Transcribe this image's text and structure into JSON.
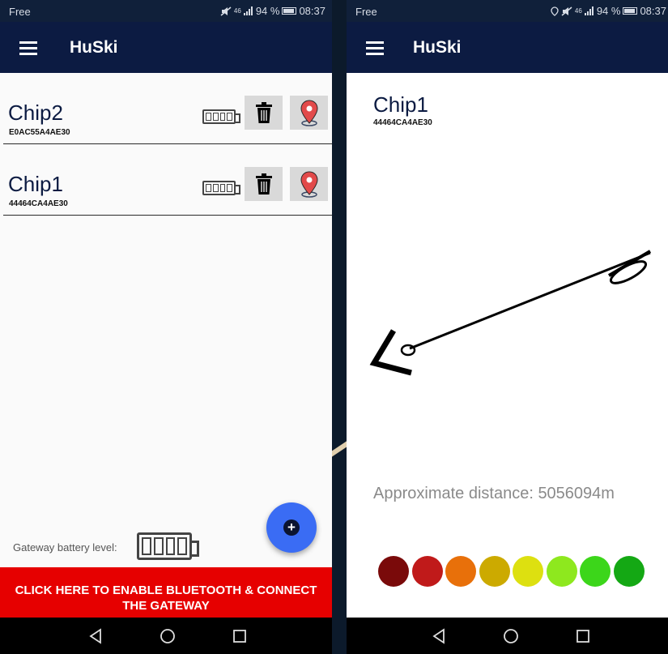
{
  "status": {
    "carrier": "Free",
    "signal_label": "46",
    "battery_percent": "94 %",
    "time": "08:37"
  },
  "app": {
    "title": "HuSki"
  },
  "chip_list": [
    {
      "name": "Chip2",
      "id": "E0AC55A4AE30"
    },
    {
      "name": "Chip1",
      "id": "44464CA4AE30"
    }
  ],
  "gateway": {
    "battery_label": "Gateway battery level:"
  },
  "bluetooth_banner": {
    "label": "CLICK HERE TO ENABLE BLUETOOTH & CONNECT THE GATEWAY"
  },
  "detail": {
    "name": "Chip1",
    "id": "44464CA4AE30",
    "distance_text": "Approximate distance: 5056094m",
    "signal_colors": [
      "#7a0a0a",
      "#c01a1a",
      "#e8700a",
      "#ccaa00",
      "#dde010",
      "#8ee81e",
      "#3cd61a",
      "#14a814"
    ]
  },
  "icons": [
    "menu-icon",
    "battery-icon",
    "trash-icon",
    "map-pin-icon",
    "plus-icon",
    "back-icon",
    "home-icon",
    "recents-icon",
    "direction-arrow-icon",
    "location-icon",
    "mute-icon",
    "signal-icon"
  ]
}
